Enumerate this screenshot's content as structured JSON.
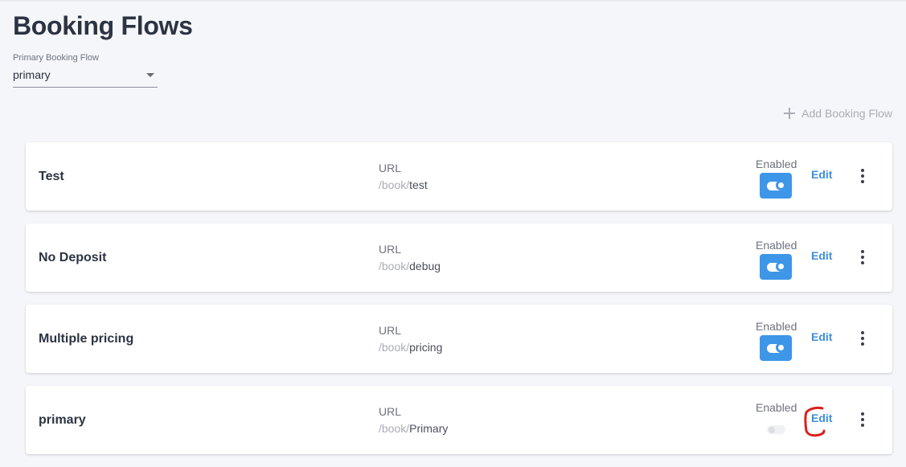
{
  "page": {
    "title": "Booking Flows"
  },
  "primary_select": {
    "label": "Primary Booking Flow",
    "value": "primary"
  },
  "actions": {
    "add_label": "Add Booking Flow"
  },
  "colors": {
    "accent": "#3d96e8",
    "link": "#3d8fdc",
    "annotation": "#d9201d"
  },
  "flows": [
    {
      "name": "Test",
      "url_label": "URL",
      "url_prefix": "/book/",
      "url_slug": "test",
      "enabled_label": "Enabled",
      "enabled": true,
      "edit_label": "Edit"
    },
    {
      "name": "No Deposit",
      "url_label": "URL",
      "url_prefix": "/book/",
      "url_slug": "debug",
      "enabled_label": "Enabled",
      "enabled": true,
      "edit_label": "Edit"
    },
    {
      "name": "Multiple pricing",
      "url_label": "URL",
      "url_prefix": "/book/",
      "url_slug": "pricing",
      "enabled_label": "Enabled",
      "enabled": true,
      "edit_label": "Edit"
    },
    {
      "name": "primary",
      "url_label": "URL",
      "url_prefix": "/book/",
      "url_slug": "Primary",
      "enabled_label": "Enabled",
      "enabled": false,
      "edit_label": "Edit",
      "annotated": true
    }
  ]
}
